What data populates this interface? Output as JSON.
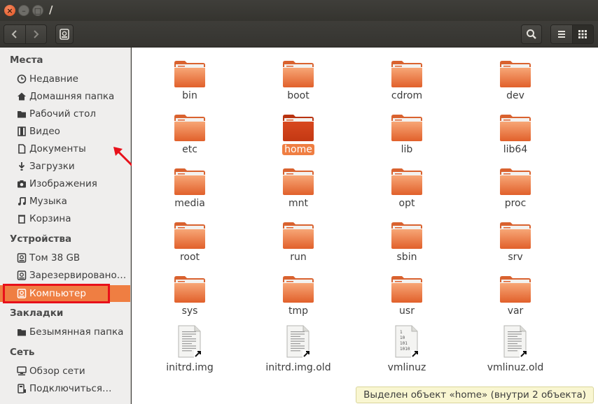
{
  "window": {
    "title": "/",
    "close_glyph": "×",
    "min_glyph": "–",
    "max_glyph": "□"
  },
  "sidebar": {
    "places_header": "Места",
    "places": [
      {
        "label": "Недавние",
        "icon": "clock-icon"
      },
      {
        "label": "Домашняя папка",
        "icon": "home-icon"
      },
      {
        "label": "Рабочий стол",
        "icon": "desktop-folder-icon"
      },
      {
        "label": "Видео",
        "icon": "film-icon"
      },
      {
        "label": "Документы",
        "icon": "document-icon"
      },
      {
        "label": "Загрузки",
        "icon": "download-icon"
      },
      {
        "label": "Изображения",
        "icon": "camera-icon"
      },
      {
        "label": "Музыка",
        "icon": "music-icon"
      },
      {
        "label": "Корзина",
        "icon": "trash-icon"
      }
    ],
    "devices_header": "Устройства",
    "devices": [
      {
        "label": "Том 38 GB",
        "icon": "drive-icon"
      },
      {
        "label": "Зарезервировано…",
        "icon": "drive-icon"
      },
      {
        "label": "Компьютер",
        "icon": "drive-icon",
        "selected": true
      }
    ],
    "bookmarks_header": "Закладки",
    "bookmarks": [
      {
        "label": "Безымянная папка",
        "icon": "folder-icon"
      }
    ],
    "network_header": "Сеть",
    "network": [
      {
        "label": "Обзор сети",
        "icon": "network-icon"
      },
      {
        "label": "Подключиться…",
        "icon": "connect-server-icon"
      }
    ]
  },
  "files": [
    {
      "name": "bin",
      "type": "folder"
    },
    {
      "name": "boot",
      "type": "folder"
    },
    {
      "name": "cdrom",
      "type": "folder"
    },
    {
      "name": "dev",
      "type": "folder"
    },
    {
      "name": "etc",
      "type": "folder"
    },
    {
      "name": "home",
      "type": "folder",
      "selected": true
    },
    {
      "name": "lib",
      "type": "folder"
    },
    {
      "name": "lib64",
      "type": "folder"
    },
    {
      "name": "media",
      "type": "folder"
    },
    {
      "name": "mnt",
      "type": "folder"
    },
    {
      "name": "opt",
      "type": "folder"
    },
    {
      "name": "proc",
      "type": "folder"
    },
    {
      "name": "root",
      "type": "folder"
    },
    {
      "name": "run",
      "type": "folder"
    },
    {
      "name": "sbin",
      "type": "folder"
    },
    {
      "name": "srv",
      "type": "folder"
    },
    {
      "name": "sys",
      "type": "folder"
    },
    {
      "name": "tmp",
      "type": "folder"
    },
    {
      "name": "usr",
      "type": "folder"
    },
    {
      "name": "var",
      "type": "folder"
    },
    {
      "name": "initrd.img",
      "type": "symlink"
    },
    {
      "name": "initrd.img.old",
      "type": "symlink"
    },
    {
      "name": "vmlinuz",
      "type": "binary-symlink"
    },
    {
      "name": "vmlinuz.old",
      "type": "symlink"
    }
  ],
  "status": "Выделен объект «home» (внутри 2 объекта)",
  "colors": {
    "accent": "#ef7e42",
    "folder_top": "#f6a070",
    "folder_bottom": "#e2612d",
    "selected_folder": "#d2401a",
    "annotation_red": "#e8101a"
  }
}
